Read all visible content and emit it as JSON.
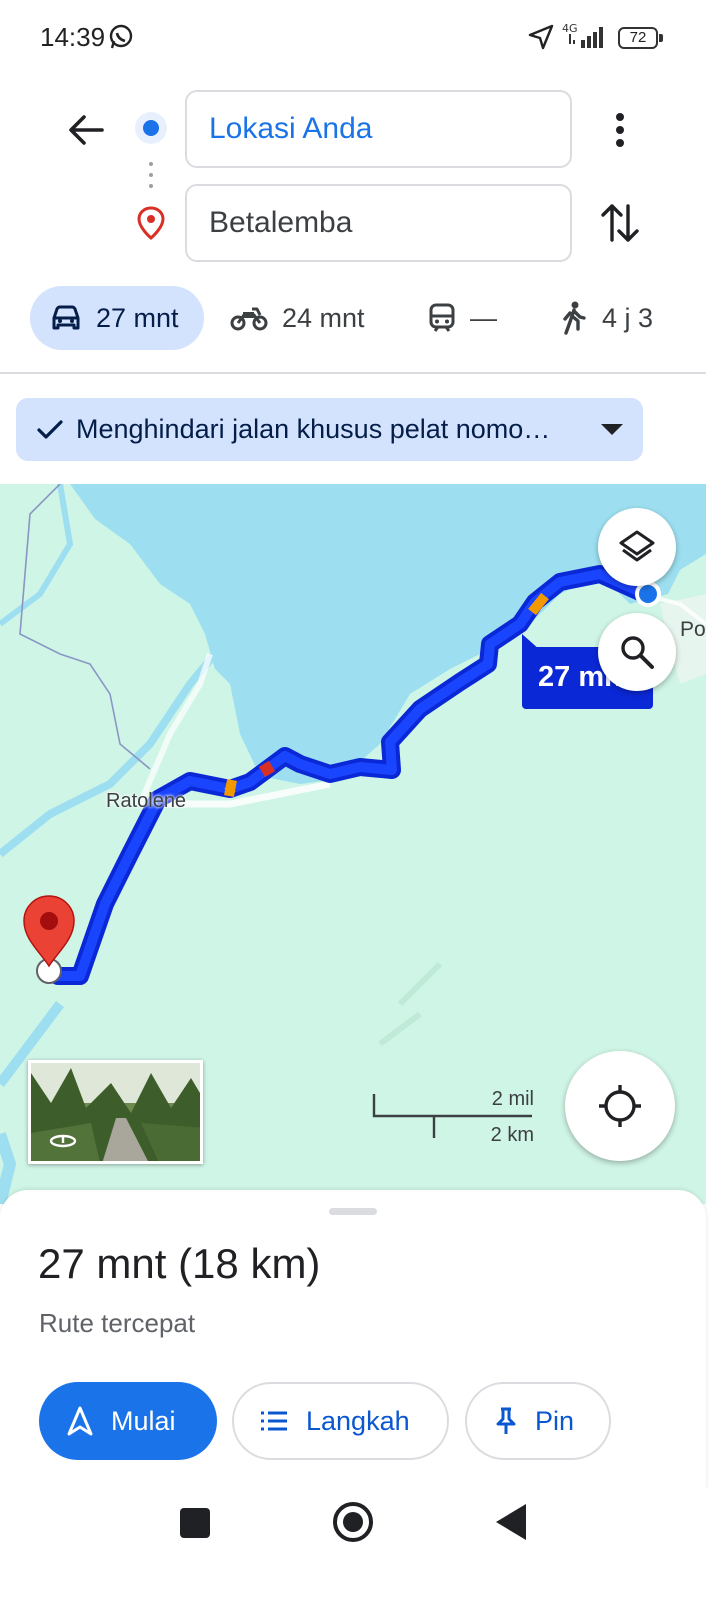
{
  "status_bar": {
    "time": "14:39",
    "network": "4G",
    "battery": "72",
    "icons": [
      "whatsapp-icon",
      "location-arrow-icon",
      "signal-icon",
      "battery-icon"
    ]
  },
  "directions": {
    "origin": "Lokasi Anda",
    "destination": "Betalemba",
    "icons": [
      "back-arrow-icon",
      "more-vert-icon",
      "swap-icon"
    ]
  },
  "travel_modes": [
    {
      "mode": "car",
      "label": "27 mnt",
      "selected": true
    },
    {
      "mode": "motorcycle",
      "label": "24 mnt"
    },
    {
      "mode": "transit",
      "label": "—"
    },
    {
      "mode": "walk",
      "label": "4 j 3"
    }
  ],
  "route_option": {
    "label": "Menghindari jalan khusus pelat nomo…"
  },
  "map": {
    "places": [
      "Ratolene",
      "Po"
    ],
    "route_label": "27 mnt",
    "scale_imperial": "2 mil",
    "scale_metric": "2 km",
    "colors": {
      "route": "#1033e6",
      "water": "#9ddff0",
      "land": "#cff5e6",
      "traffic_slow": "#f29900",
      "traffic_jam": "#d93025"
    }
  },
  "summary": {
    "duration_distance": "27 mnt (18 km)",
    "description": "Rute tercepat"
  },
  "actions": {
    "start": "Mulai",
    "steps": "Langkah",
    "pin": "Pin"
  },
  "colors": {
    "accent": "#1a73e8",
    "chip_bg": "#d3e3fd"
  }
}
